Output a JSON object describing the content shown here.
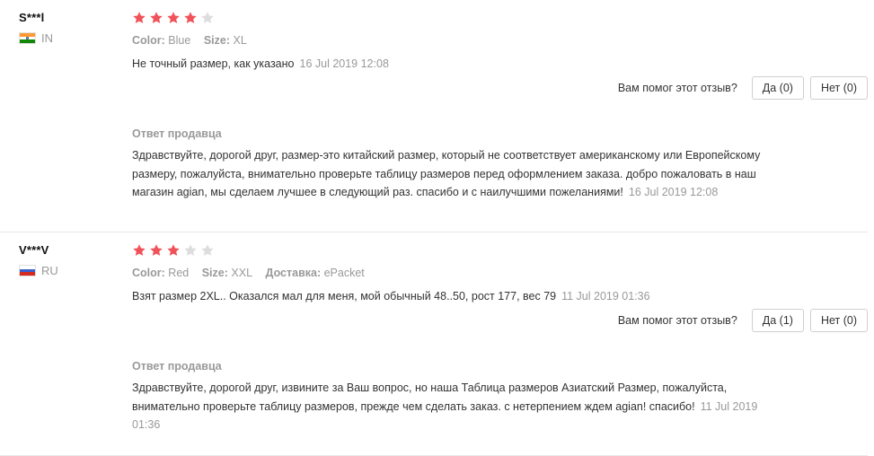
{
  "colors": {
    "star_filled": "#f0525a",
    "star_empty": "#dddddd"
  },
  "reviews": [
    {
      "username": "S***l",
      "country": "IN",
      "flag": "india-flag-icon",
      "rating": 4,
      "attributes": [
        {
          "label": "Color:",
          "value": "Blue"
        },
        {
          "label": "Size:",
          "value": "XL"
        }
      ],
      "text": "Не точный размер, как указано",
      "date": "16 Jul 2019 12:08",
      "helpful_question": "Вам помог этот отзыв?",
      "yes_label": "Да (0)",
      "no_label": "Нет (0)",
      "seller_title": "Ответ продавца",
      "seller_text": "Здравствуйте, дорогой друг, размер-это китайский размер, который не соответствует американскому или Европейскому размеру, пожалуйста, внимательно проверьте таблицу размеров перед оформлением заказа. добро пожаловать в наш магазин agian, мы сделаем лучшее в следующий раз. спасибо и с наилучшими пожеланиями!",
      "seller_date": "16 Jul 2019 12:08"
    },
    {
      "username": "V***V",
      "country": "RU",
      "flag": "russia-flag-icon",
      "rating": 3,
      "attributes": [
        {
          "label": "Color:",
          "value": "Red"
        },
        {
          "label": "Size:",
          "value": "XXL"
        },
        {
          "label": "Доставка:",
          "value": "ePacket"
        }
      ],
      "text": "Взят размер 2XL.. Оказался мал для меня, мой обычный 48..50, рост 177, вес 79",
      "date": "11 Jul 2019 01:36",
      "helpful_question": "Вам помог этот отзыв?",
      "yes_label": "Да (1)",
      "no_label": "Нет (0)",
      "seller_title": "Ответ продавца",
      "seller_text": "Здравствуйте, дорогой друг, извините за Ваш вопрос, но наша Таблица размеров Азиатский Размер, пожалуйста, внимательно проверьте таблицу размеров, прежде чем сделать заказ. с нетерпением ждем agian! спасибо!",
      "seller_date": "11 Jul 2019 01:36"
    }
  ]
}
